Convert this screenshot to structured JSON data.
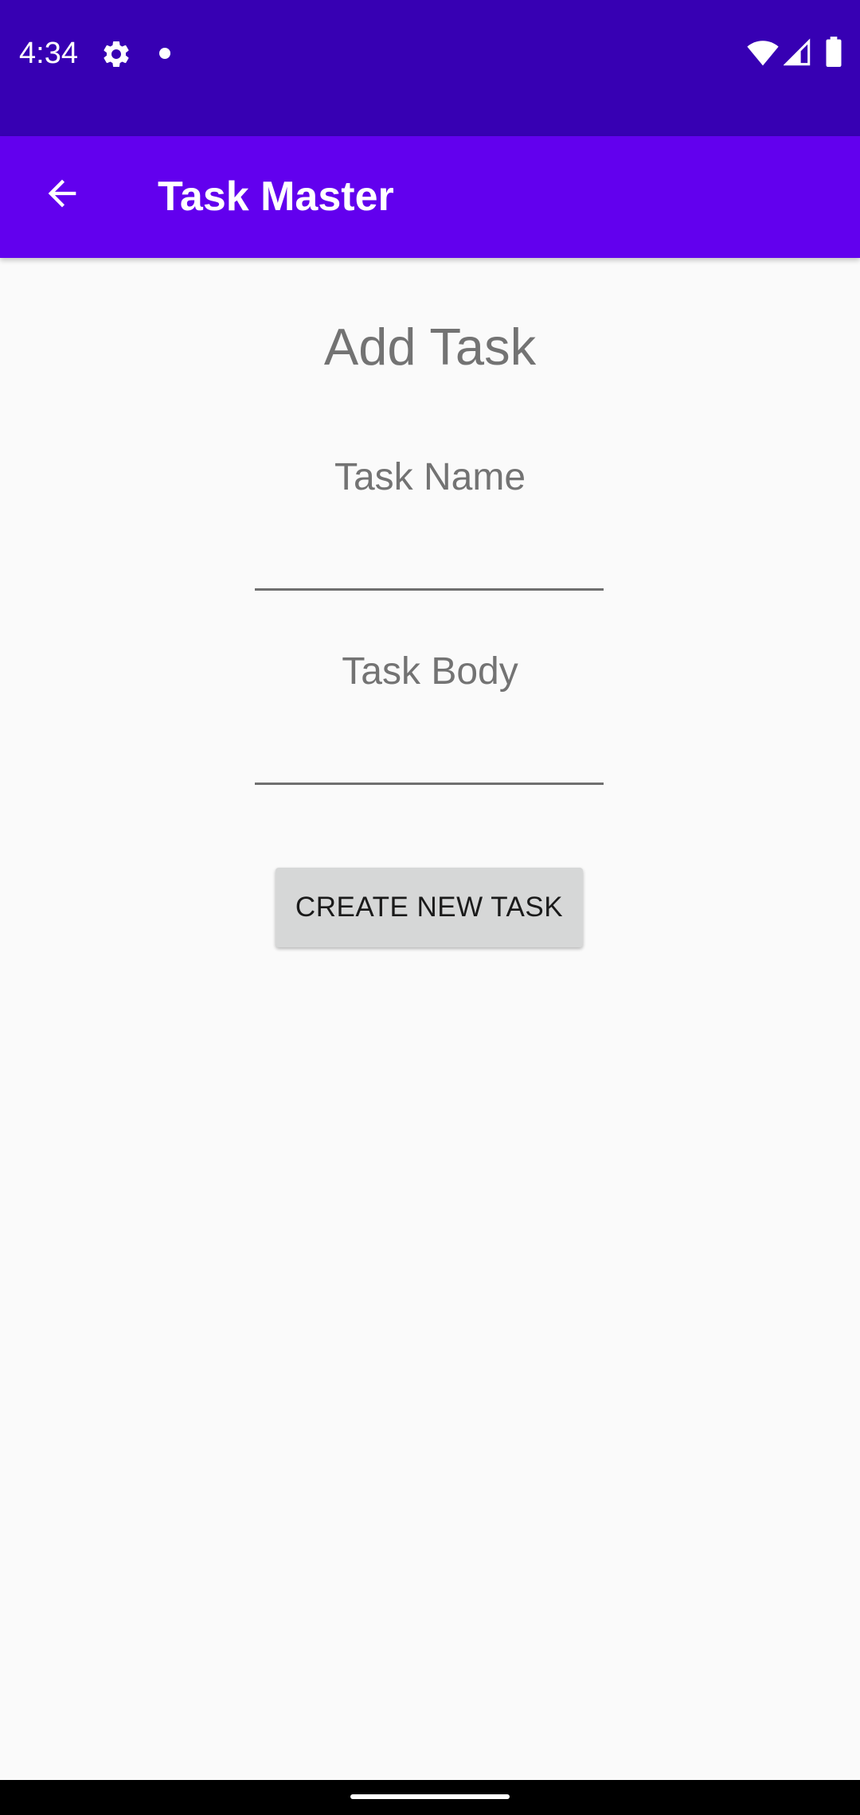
{
  "status_bar": {
    "time": "4:34",
    "icons": [
      "settings-icon",
      "notification-dot-icon",
      "wifi-icon",
      "signal-icon",
      "battery-icon"
    ]
  },
  "app_bar": {
    "title": "Task Master",
    "back_icon": "arrow-back-icon"
  },
  "form": {
    "heading": "Add Task",
    "task_name_label": "Task Name",
    "task_name_value": "",
    "task_body_label": "Task Body",
    "task_body_value": "",
    "submit_label": "CREATE NEW TASK"
  },
  "colors": {
    "status_bar": "#3700b3",
    "app_bar": "#6200ee",
    "background": "#fafafa",
    "button": "#d6d7d7",
    "label_text": "#737373"
  }
}
